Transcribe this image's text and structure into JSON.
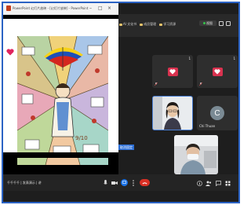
{
  "window": {
    "ppt_title": "PowerPoint 幻灯片放映 - [幻灯片放映] - PowerPoint"
  },
  "header": {
    "links": [
      "AI 文化书",
      "成员管理",
      "学习资源"
    ],
    "view_button": "视图",
    "link_color": "#e8c36a"
  },
  "tiles": {
    "heart1": {
      "num": "1"
    },
    "heart2": {
      "num": "1"
    },
    "teacher": {
      "num": ""
    },
    "user_c": {
      "initial": "C",
      "label": "Chi Thuan"
    }
  },
  "pin_badge": "取消固定",
  "controls": {
    "left_text": "千千千千 | 发表演示 | 讲",
    "colors": {
      "end_call": "#d93025",
      "active": "#1a73e8",
      "panel": "#242424"
    }
  },
  "colors": {
    "frame": "#2b63c4",
    "background": "#1e1e1e",
    "heart": "#d9324f"
  }
}
